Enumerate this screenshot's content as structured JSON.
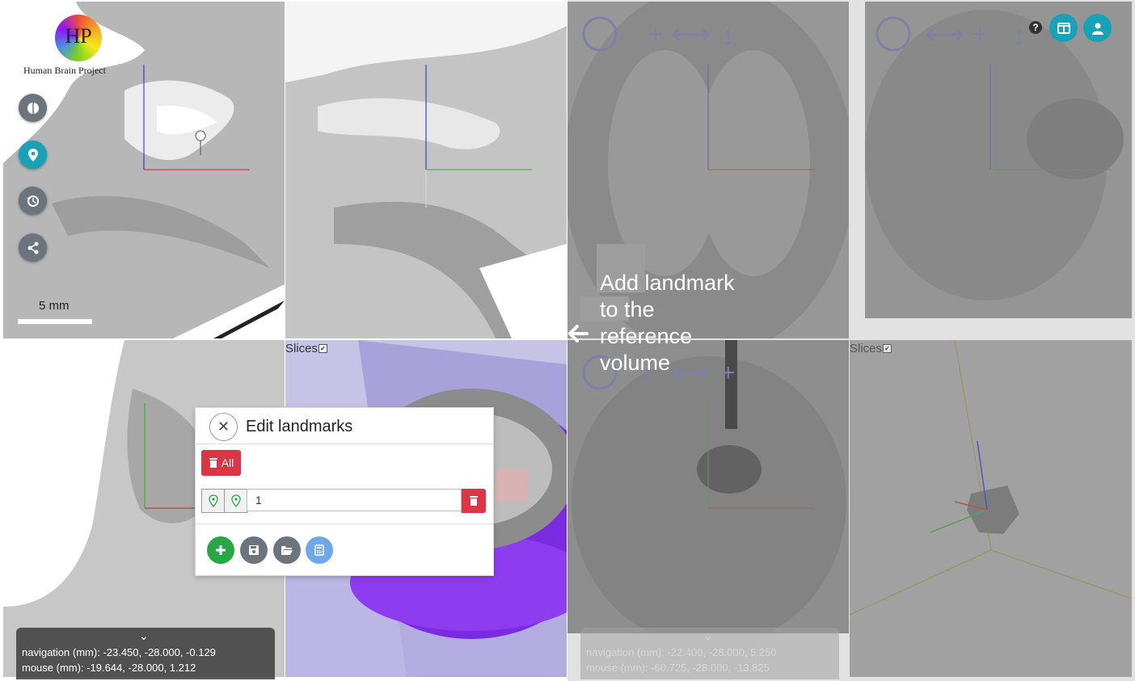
{
  "branding": {
    "logo_monogram": "HP",
    "logo_text": "Human Brain Project"
  },
  "sidebar": {
    "buttons": [
      {
        "icon": "brain-icon",
        "active": false
      },
      {
        "icon": "map-marker-icon",
        "active": true
      },
      {
        "icon": "history-icon",
        "active": false
      },
      {
        "icon": "share-icon",
        "active": false
      }
    ]
  },
  "scale_bar": {
    "label": "5 mm"
  },
  "top_right": {
    "help": "?",
    "buttons": [
      {
        "icon": "layout-icon"
      },
      {
        "icon": "user-icon"
      }
    ]
  },
  "views": {
    "left_3d": {
      "slices_label": "Slices"
    },
    "right_3d": {
      "slices_label": "Slices"
    }
  },
  "navigation_left": {
    "navigation": "navigation (mm): -23.450, -28.000, -0.129",
    "mouse": "mouse (mm): -19.644, -28.000, 1.212"
  },
  "navigation_right": {
    "navigation": "navigation (mm): -22.400, -28.000, 5.250",
    "mouse": "mouse (mm): -60.725, -28.000, -13.825"
  },
  "tooltip": {
    "text": "Add landmark to the reference volume",
    "arrow": "🡐"
  },
  "dialog": {
    "title": "Edit landmarks",
    "delete_all_label": "All",
    "landmarks": [
      {
        "name": "1"
      }
    ],
    "actions": [
      "add-icon",
      "save-icon",
      "folder-open-icon",
      "calculator-icon"
    ]
  },
  "colors": {
    "accent": "#17a2b8",
    "danger": "#dc3545",
    "success": "#28a745",
    "secondary": "#6c757d",
    "info_light": "#6fa8e8"
  }
}
